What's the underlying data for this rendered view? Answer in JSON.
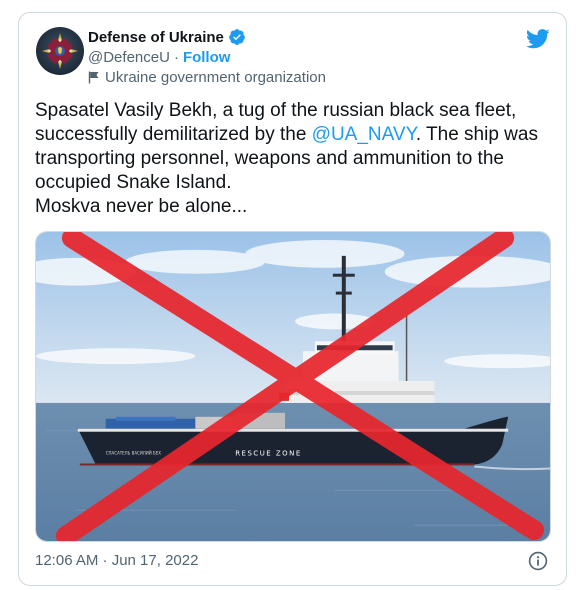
{
  "author": {
    "display_name": "Defense of Ukraine",
    "handle": "@DefenceU",
    "separator": "·",
    "follow_label": "Follow",
    "affiliation": "Ukraine government organization"
  },
  "tweet": {
    "text_before_mention": "Spasatel Vasily Bekh, a tug of the russian black sea fleet, successfully demilitarized by the ",
    "mention": "@UA_NAVY",
    "text_after_mention": ". The ship was transporting personnel, weapons and ammunition to the occupied Snake Island.",
    "text_line_last": "Moskva never be alone...",
    "timestamp": "12:06 AM · Jun 17, 2022"
  },
  "media": {
    "ship_hull_text": "RESCUE ZONE",
    "ship_name_text": "СПАСАТЕЛЬ ВАСИЛИЙ БЕХ"
  },
  "icons": {
    "verified": "verified-badge-icon",
    "twitter": "twitter-bird-icon",
    "flag": "flag-icon",
    "info": "info-icon"
  },
  "colors": {
    "accent": "#1d9bf0",
    "text_primary": "#0f1419",
    "text_secondary": "#536471",
    "cross_red": "#e8262d",
    "border": "#cfd9de"
  }
}
